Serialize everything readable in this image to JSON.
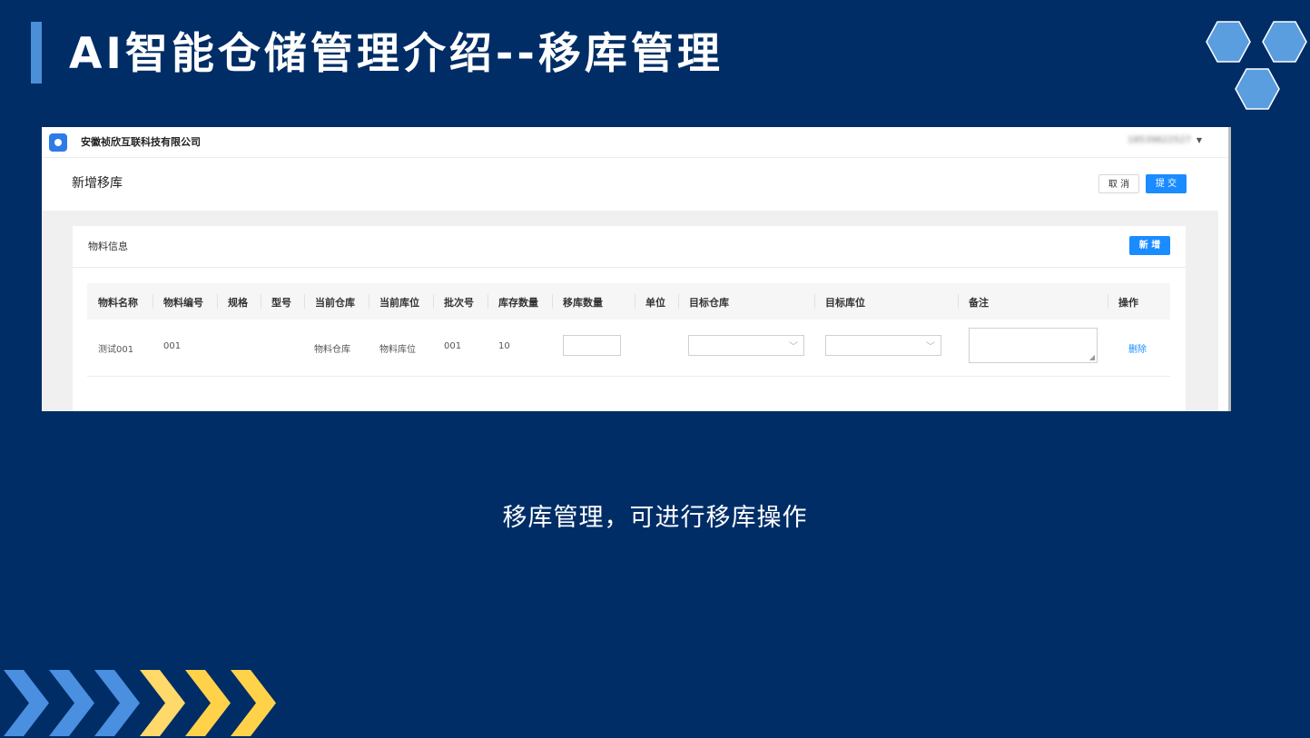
{
  "slide": {
    "title": "AI智能仓储管理介绍--移库管理",
    "caption": "移库管理，可进行移库操作",
    "colors": {
      "background": "#002d66",
      "accent": "#4a90d9",
      "chevron_blue": "#4a8fe0",
      "chevron_yellow": "#ffd24a"
    }
  },
  "app": {
    "company": "安徽祯欣互联科技有限公司",
    "user": "18539622527",
    "page_title": "新增移库",
    "cancel_label": "取 消",
    "submit_label": "提 交",
    "section_title": "物料信息",
    "add_label": "新 增"
  },
  "table": {
    "headers": [
      "物料名称",
      "物料编号",
      "规格",
      "型号",
      "当前仓库",
      "当前库位",
      "批次号",
      "库存数量",
      "移库数量",
      "单位",
      "目标仓库",
      "目标库位",
      "备注",
      "操作"
    ],
    "rows": [
      {
        "name": "测试001",
        "code": "001",
        "spec": "",
        "model": "",
        "current_warehouse": "物料仓库",
        "current_location": "物料库位",
        "batch": "001",
        "stock": "10",
        "move_qty": "",
        "unit": "",
        "target_warehouse": "",
        "target_location": "",
        "remark": "",
        "action": "删除"
      }
    ]
  }
}
